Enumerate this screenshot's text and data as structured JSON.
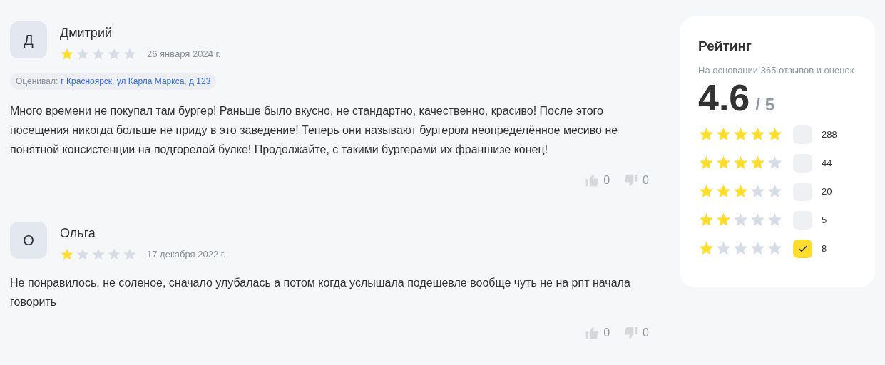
{
  "reviews": [
    {
      "initial": "Д",
      "name": "Дмитрий",
      "stars": 1,
      "date": "26 января 2024 г.",
      "rated_at": {
        "label": "Оценивал:",
        "place": "г Красноярск, ул Карла Маркса, д 123"
      },
      "text": "Много времени не покупал там бургер! Раньше было вкусно, не стандартно, качественно, красиво! После этого посещения никогда больше не приду в это заведение! Теперь они называют бургером неопределённое месиво не понятной консистенции на подгорелой булке! Продолжайте, с такими бургерами их франшизе конец!",
      "likes": "0",
      "dislikes": "0"
    },
    {
      "initial": "О",
      "name": "Ольга",
      "stars": 1,
      "date": "17 декабря 2022 г.",
      "text": "Не понравилось, не соленое, сначало улубалась а потом когда услышала подешевле вообще чуть не на рпт начала говорить",
      "likes": "0",
      "dislikes": "0"
    }
  ],
  "rating": {
    "title": "Рейтинг",
    "subtitle": "На основании 365 отзывов и оценок",
    "score": "4.6",
    "out_of": "/ 5",
    "filters": [
      {
        "stars": 5,
        "checked": false,
        "count": "288"
      },
      {
        "stars": 4,
        "checked": false,
        "count": "44"
      },
      {
        "stars": 3,
        "checked": false,
        "count": "20"
      },
      {
        "stars": 2,
        "checked": false,
        "count": "5"
      },
      {
        "stars": 1,
        "checked": true,
        "count": "8"
      }
    ]
  }
}
